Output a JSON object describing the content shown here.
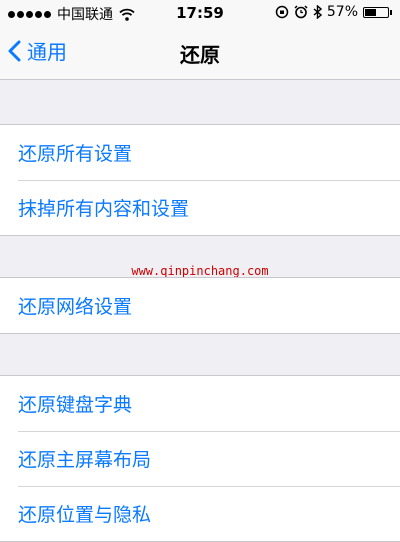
{
  "status": {
    "carrier": "中国联通",
    "time": "17:59",
    "battery_percent": "57%",
    "battery_level": 0.57,
    "signal_dots": 5,
    "icons": [
      "wifi-icon",
      "rotation-lock-icon",
      "alarm-icon",
      "bluetooth-icon",
      "battery-icon"
    ]
  },
  "nav": {
    "back_label": "通用",
    "title": "还原"
  },
  "groups": [
    {
      "items": [
        "还原所有设置",
        "抹掉所有内容和设置"
      ]
    },
    {
      "items": [
        "还原网络设置"
      ]
    },
    {
      "items": [
        "还原键盘字典",
        "还原主屏幕布局",
        "还原位置与隐私"
      ]
    }
  ],
  "watermark": "www.qinpinchang.com",
  "colors": {
    "accent": "#0a7aff",
    "background": "#efeff4",
    "watermark": "#cc0000"
  }
}
